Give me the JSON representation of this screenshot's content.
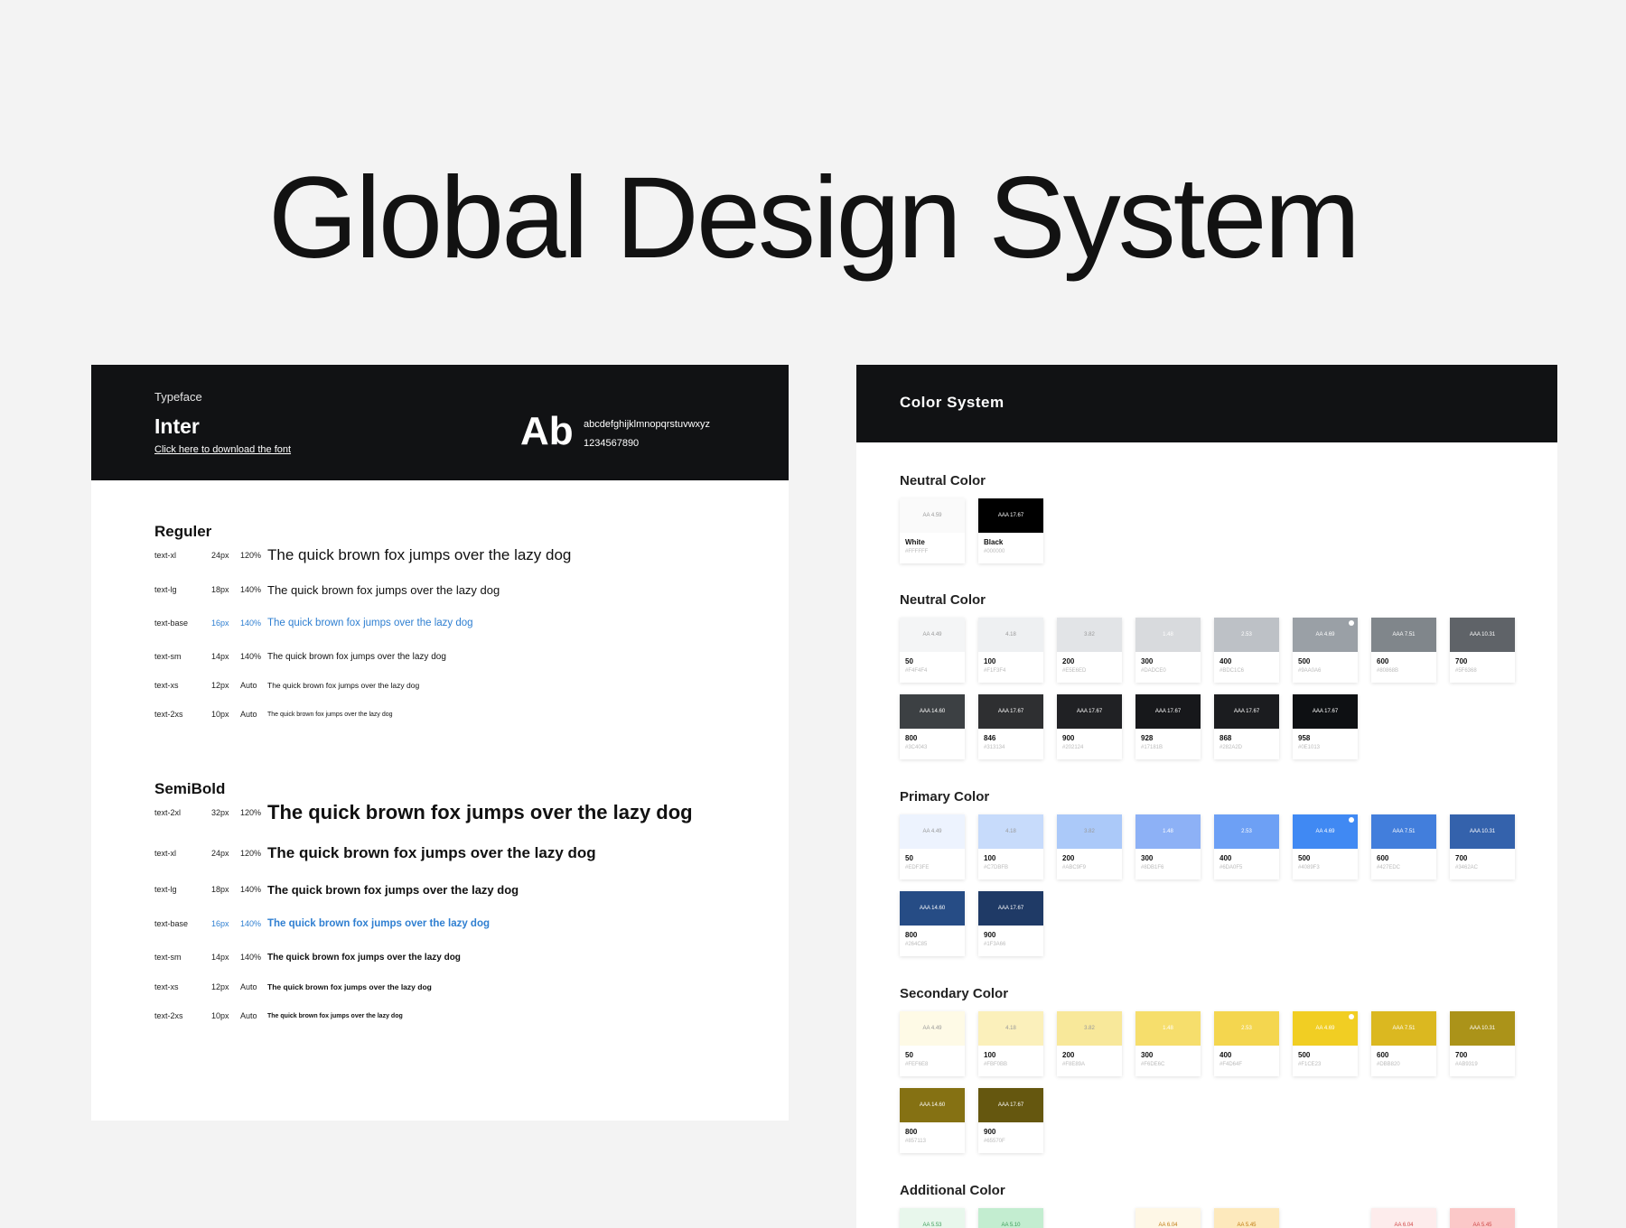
{
  "title": "Global Design System",
  "typeface": {
    "label": "Typeface",
    "name": "Inter",
    "link": "Click here to download the font",
    "sample_glyph": "Ab",
    "alphabet": "abcdefghijklmnopqrstuvwxyz",
    "digits": "1234567890"
  },
  "regular": {
    "title": "Reguler",
    "rows": [
      {
        "token": "text-xl",
        "size": "24px",
        "lh": "120%",
        "sample": "The quick brown fox jumps over the lazy dog"
      },
      {
        "token": "text-lg",
        "size": "18px",
        "lh": "140%",
        "sample": "The quick brown fox jumps over the lazy dog"
      },
      {
        "token": "text-base",
        "size": "16px",
        "lh": "140%",
        "sample": "The quick brown fox jumps over the lazy dog"
      },
      {
        "token": "text-sm",
        "size": "14px",
        "lh": "140%",
        "sample": "The quick brown fox jumps over the lazy dog"
      },
      {
        "token": "text-xs",
        "size": "12px",
        "lh": "Auto",
        "sample": "The quick brown fox jumps over the lazy dog"
      },
      {
        "token": "text-2xs",
        "size": "10px",
        "lh": "Auto",
        "sample": "The quick brown fox jumps over the lazy dog"
      }
    ]
  },
  "semibold": {
    "title": "SemiBold",
    "rows": [
      {
        "token": "text-2xl",
        "size": "32px",
        "lh": "120%",
        "sample": "The quick brown fox jumps over the lazy dog"
      },
      {
        "token": "text-xl",
        "size": "24px",
        "lh": "120%",
        "sample": "The quick brown fox jumps over the lazy dog"
      },
      {
        "token": "text-lg",
        "size": "18px",
        "lh": "140%",
        "sample": "The quick brown fox jumps over the lazy dog"
      },
      {
        "token": "text-base",
        "size": "16px",
        "lh": "140%",
        "sample": "The quick brown fox jumps over the lazy dog"
      },
      {
        "token": "text-sm",
        "size": "14px",
        "lh": "140%",
        "sample": "The quick brown fox jumps over the lazy dog"
      },
      {
        "token": "text-xs",
        "size": "12px",
        "lh": "Auto",
        "sample": "The quick brown fox jumps over the lazy dog"
      },
      {
        "token": "text-2xs",
        "size": "10px",
        "lh": "Auto",
        "sample": "The quick brown fox jumps over the lazy dog"
      }
    ]
  },
  "color_system": {
    "title": "Color  System",
    "groups": [
      {
        "title": "Neutral Color",
        "swatches": [
          {
            "name": "White",
            "hex": "#FFFFFF",
            "badge": "AA 4.59",
            "color": "#FFFFFF",
            "text": "#999999"
          },
          {
            "name": "Black",
            "hex": "#000000",
            "badge": "AAA 17.67",
            "color": "#000000",
            "text": "#FFFFFF"
          }
        ]
      },
      {
        "title": "Neutral Color",
        "swatches": [
          {
            "name": "50",
            "hex": "#F4F4F4",
            "badge": "AA 4.49",
            "color": "#F4F5F6",
            "text": "#999999"
          },
          {
            "name": "100",
            "hex": "#F1F3F4",
            "badge": "4.18",
            "color": "#EEF0F2",
            "text": "#999999"
          },
          {
            "name": "200",
            "hex": "#E5E6ED",
            "badge": "3.82",
            "color": "#E2E4E7",
            "text": "#999999"
          },
          {
            "name": "300",
            "hex": "#DADCE0",
            "badge": "1.48",
            "color": "#D8DADD",
            "text": "#FFFFFF"
          },
          {
            "name": "400",
            "hex": "#BDC1C6",
            "badge": "2.53",
            "color": "#BDC1C6",
            "text": "#FFFFFF"
          },
          {
            "name": "500",
            "hex": "#9AA0A6",
            "badge": "AA 4.69",
            "color": "#9AA0A6",
            "text": "#FFFFFF",
            "dot": true
          },
          {
            "name": "600",
            "hex": "#80868B",
            "badge": "AAA 7.51",
            "color": "#80868B",
            "text": "#FFFFFF"
          },
          {
            "name": "700",
            "hex": "#5F6368",
            "badge": "AAA 10.31",
            "color": "#5F6368",
            "text": "#FFFFFF"
          },
          {
            "name": "800",
            "hex": "#3C4043",
            "badge": "AAA 14.60",
            "color": "#3C4043",
            "text": "#FFFFFF"
          },
          {
            "name": "846",
            "hex": "#313134",
            "badge": "AAA 17.67",
            "color": "#2E2F31",
            "text": "#FFFFFF"
          },
          {
            "name": "900",
            "hex": "#202124",
            "badge": "AAA 17.67",
            "color": "#202124",
            "text": "#FFFFFF"
          },
          {
            "name": "928",
            "hex": "#17181B",
            "badge": "AAA 17.67",
            "color": "#17181B",
            "text": "#FFFFFF"
          },
          {
            "name": "868",
            "hex": "#282A2D",
            "badge": "AAA 17.67",
            "color": "#1B1C1F",
            "text": "#FFFFFF"
          },
          {
            "name": "958",
            "hex": "#0E1013",
            "badge": "AAA 17.67",
            "color": "#0E1013",
            "text": "#FFFFFF"
          }
        ]
      },
      {
        "title": "Primary Color",
        "swatches": [
          {
            "name": "50",
            "hex": "#EDF3FE",
            "badge": "AA 4.49",
            "color": "#EDF3FE",
            "text": "#999999"
          },
          {
            "name": "100",
            "hex": "#C7DBFB",
            "badge": "4.18",
            "color": "#C7DBFB",
            "text": "#999999"
          },
          {
            "name": "200",
            "hex": "#ABC9F9",
            "badge": "3.82",
            "color": "#ABC9F9",
            "text": "#999999"
          },
          {
            "name": "300",
            "hex": "#8DB1F6",
            "badge": "1.48",
            "color": "#8DB1F6",
            "text": "#FFFFFF"
          },
          {
            "name": "400",
            "hex": "#6DA0F5",
            "badge": "2.53",
            "color": "#6DA0F5",
            "text": "#FFFFFF"
          },
          {
            "name": "500",
            "hex": "#4089F3",
            "badge": "AA 4.69",
            "color": "#4089F3",
            "text": "#FFFFFF",
            "dot": true
          },
          {
            "name": "600",
            "hex": "#427EDC",
            "badge": "AAA 7.51",
            "color": "#427EDC",
            "text": "#FFFFFF"
          },
          {
            "name": "700",
            "hex": "#3462AC",
            "badge": "AAA 10.31",
            "color": "#3462AC",
            "text": "#FFFFFF"
          },
          {
            "name": "800",
            "hex": "#264C85",
            "badge": "AAA 14.60",
            "color": "#264C85",
            "text": "#FFFFFF"
          },
          {
            "name": "900",
            "hex": "#1F3A66",
            "badge": "AAA 17.67",
            "color": "#1F3A66",
            "text": "#FFFFFF"
          }
        ]
      },
      {
        "title": "Secondary Color",
        "swatches": [
          {
            "name": "50",
            "hex": "#FEF6E8",
            "badge": "AA 4.49",
            "color": "#FEFAE6",
            "text": "#999999"
          },
          {
            "name": "100",
            "hex": "#FBF0BB",
            "badge": "4.18",
            "color": "#FBF0BB",
            "text": "#999999"
          },
          {
            "name": "200",
            "hex": "#F8E89A",
            "badge": "3.82",
            "color": "#F8E89A",
            "text": "#999999"
          },
          {
            "name": "300",
            "hex": "#F6DE6C",
            "badge": "1.48",
            "color": "#F6DE6C",
            "text": "#FFFFFF"
          },
          {
            "name": "400",
            "hex": "#F4D64F",
            "badge": "2.53",
            "color": "#F4D64F",
            "text": "#FFFFFF"
          },
          {
            "name": "500",
            "hex": "#F1CE23",
            "badge": "AA 4.69",
            "color": "#F1CE23",
            "text": "#FFFFFF",
            "dot": true
          },
          {
            "name": "600",
            "hex": "#DBB820",
            "badge": "AAA 7.51",
            "color": "#DBB820",
            "text": "#FFFFFF"
          },
          {
            "name": "700",
            "hex": "#AB9319",
            "badge": "AAA 10.31",
            "color": "#AB9319",
            "text": "#FFFFFF"
          },
          {
            "name": "800",
            "hex": "#857113",
            "badge": "AAA 14.60",
            "color": "#857113",
            "text": "#FFFFFF"
          },
          {
            "name": "900",
            "hex": "#65570F",
            "badge": "AAA 17.67",
            "color": "#65570F",
            "text": "#FFFFFF"
          }
        ]
      },
      {
        "title": "Additional Color",
        "swatches": [
          {
            "name": "",
            "hex": "",
            "badge": "AA 5.53",
            "color": "#E8F7EC",
            "text": "#3E9E5A",
            "col": 0
          },
          {
            "name": "",
            "hex": "",
            "badge": "AA 5.10",
            "color": "#C3EDD0",
            "text": "#3E9E5A",
            "col": 1
          },
          {
            "name": "",
            "hex": "",
            "badge": "AA 6.04",
            "color": "#FEF7E6",
            "text": "#C07A10",
            "col": 3
          },
          {
            "name": "",
            "hex": "",
            "badge": "AA 5.45",
            "color": "#FDE9BC",
            "text": "#C07A10",
            "col": 4
          },
          {
            "name": "",
            "hex": "",
            "badge": "AA 6.04",
            "color": "#FDECEC",
            "text": "#D04848",
            "col": 6
          },
          {
            "name": "",
            "hex": "",
            "badge": "AA 5.45",
            "color": "#FBC8C8",
            "text": "#D04848",
            "col": 7
          }
        ]
      }
    ]
  }
}
